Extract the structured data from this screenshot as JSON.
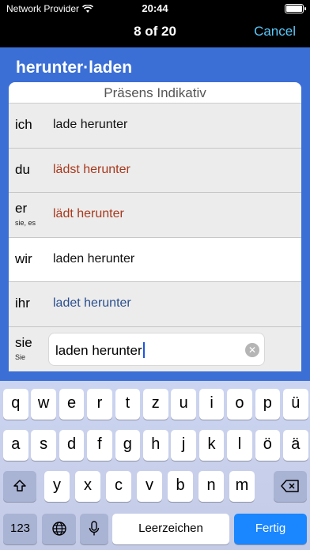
{
  "status": {
    "carrier": "Network Provider",
    "time": "20:44"
  },
  "nav": {
    "title": "8 of 20",
    "cancel": "Cancel"
  },
  "verb": "herunter·laden",
  "tense": "Präsens Indikativ",
  "rows": [
    {
      "pronoun": "ich",
      "sub": "",
      "form": "lade herunter",
      "tone": "black"
    },
    {
      "pronoun": "du",
      "sub": "",
      "form": "lädst herunter",
      "tone": "red"
    },
    {
      "pronoun": "er",
      "sub": "sie, es",
      "form": "lädt herunter",
      "tone": "red"
    },
    {
      "pronoun": "wir",
      "sub": "",
      "form": "laden herunter",
      "tone": "black"
    },
    {
      "pronoun": "ihr",
      "sub": "",
      "form": "ladet herunter",
      "tone": "blue"
    }
  ],
  "answer": {
    "pronoun": "sie",
    "sub": "Sie",
    "value": "laden herunter"
  },
  "keyboard": {
    "row1": [
      "q",
      "w",
      "e",
      "r",
      "t",
      "z",
      "u",
      "i",
      "o",
      "p",
      "ü"
    ],
    "row2": [
      "a",
      "s",
      "d",
      "f",
      "g",
      "h",
      "j",
      "k",
      "l",
      "ö",
      "ä"
    ],
    "row3": [
      "y",
      "x",
      "c",
      "v",
      "b",
      "n",
      "m"
    ],
    "numbers": "123",
    "space": "Leerzeichen",
    "return": "Fertig"
  },
  "colors": {
    "accent": "#3b6fd6",
    "cancel": "#5ac8fa",
    "irregular": "#a8391d",
    "regular_alt": "#2b4f8e",
    "return_key": "#1a86ff"
  },
  "icons": {
    "wifi": "wifi-icon",
    "battery": "battery-icon",
    "clear": "clear-icon",
    "shift": "shift-icon",
    "delete": "backspace-icon",
    "globe": "globe-icon",
    "mic": "microphone-icon"
  }
}
